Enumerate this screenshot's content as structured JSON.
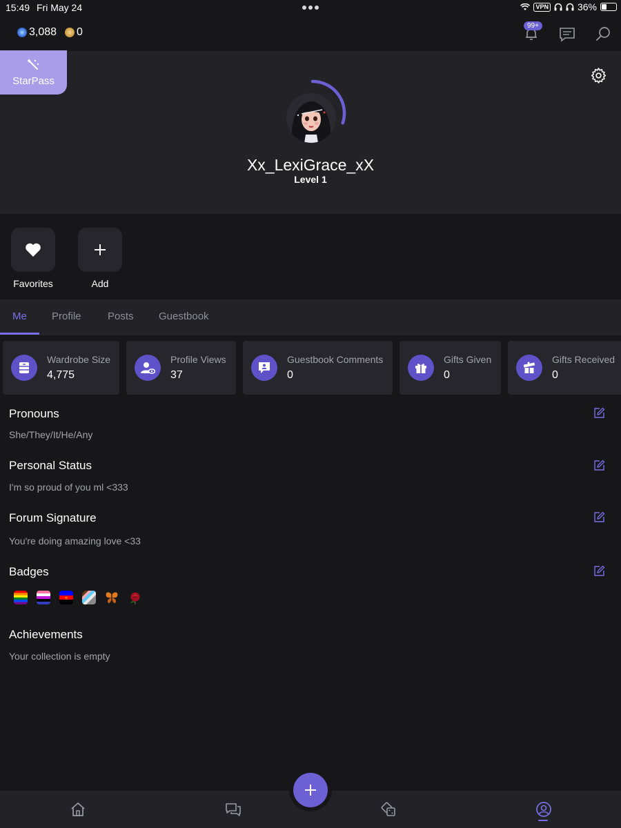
{
  "status_bar": {
    "time": "15:49",
    "date": "Fri May 24",
    "vpn": "VPN",
    "battery": "36%",
    "battery_level": 0.36
  },
  "topbar": {
    "gems": "3,088",
    "coins": "0",
    "notifications_badge": "99+"
  },
  "starpass": {
    "label": "StarPass"
  },
  "profile": {
    "username": "Xx_LexiGrace_xX",
    "level": "Level 1",
    "level_progress": 0.3
  },
  "quick_actions": [
    {
      "label": "Favorites",
      "icon": "heart-icon"
    },
    {
      "label": "Add",
      "icon": "plus-icon"
    }
  ],
  "tabs": [
    {
      "label": "Me",
      "active": true
    },
    {
      "label": "Profile"
    },
    {
      "label": "Posts"
    },
    {
      "label": "Guestbook"
    }
  ],
  "stats": [
    {
      "label": "Wardrobe Size",
      "value": "4,775",
      "icon": "wardrobe-icon"
    },
    {
      "label": "Profile Views",
      "value": "37",
      "icon": "profile-views-icon"
    },
    {
      "label": "Guestbook Comments",
      "value": "0",
      "icon": "guestbook-icon"
    },
    {
      "label": "Gifts Given",
      "value": "0",
      "icon": "gift-icon"
    },
    {
      "label": "Gifts Received",
      "value": "0",
      "icon": "gift-open-icon"
    }
  ],
  "sections": {
    "pronouns": {
      "title": "Pronouns",
      "text": "She/They/It/He/Any"
    },
    "personal_status": {
      "title": "Personal Status",
      "text": "I'm so proud of you ml <333"
    },
    "forum_signature": {
      "title": "Forum Signature",
      "text": "You're doing amazing love <33"
    },
    "badges": {
      "title": "Badges",
      "items": [
        "rainbow-flag-badge",
        "genderfluid-flag-badge",
        "polyamory-flag-badge",
        "progress-flag-badge",
        "butterfly-badge",
        "rose-badge"
      ]
    },
    "achievements": {
      "title": "Achievements",
      "text": "Your collection is empty"
    }
  },
  "colors": {
    "accent": "#6d5fd4",
    "background": "#17171a",
    "panel": "#222227",
    "card": "#26262c",
    "starpass": "#a99ce8"
  },
  "bottom_nav": [
    {
      "icon": "home-icon"
    },
    {
      "icon": "chat-icon"
    },
    {
      "icon": "create-icon"
    },
    {
      "icon": "games-icon"
    },
    {
      "icon": "profile-icon",
      "active": true
    }
  ]
}
